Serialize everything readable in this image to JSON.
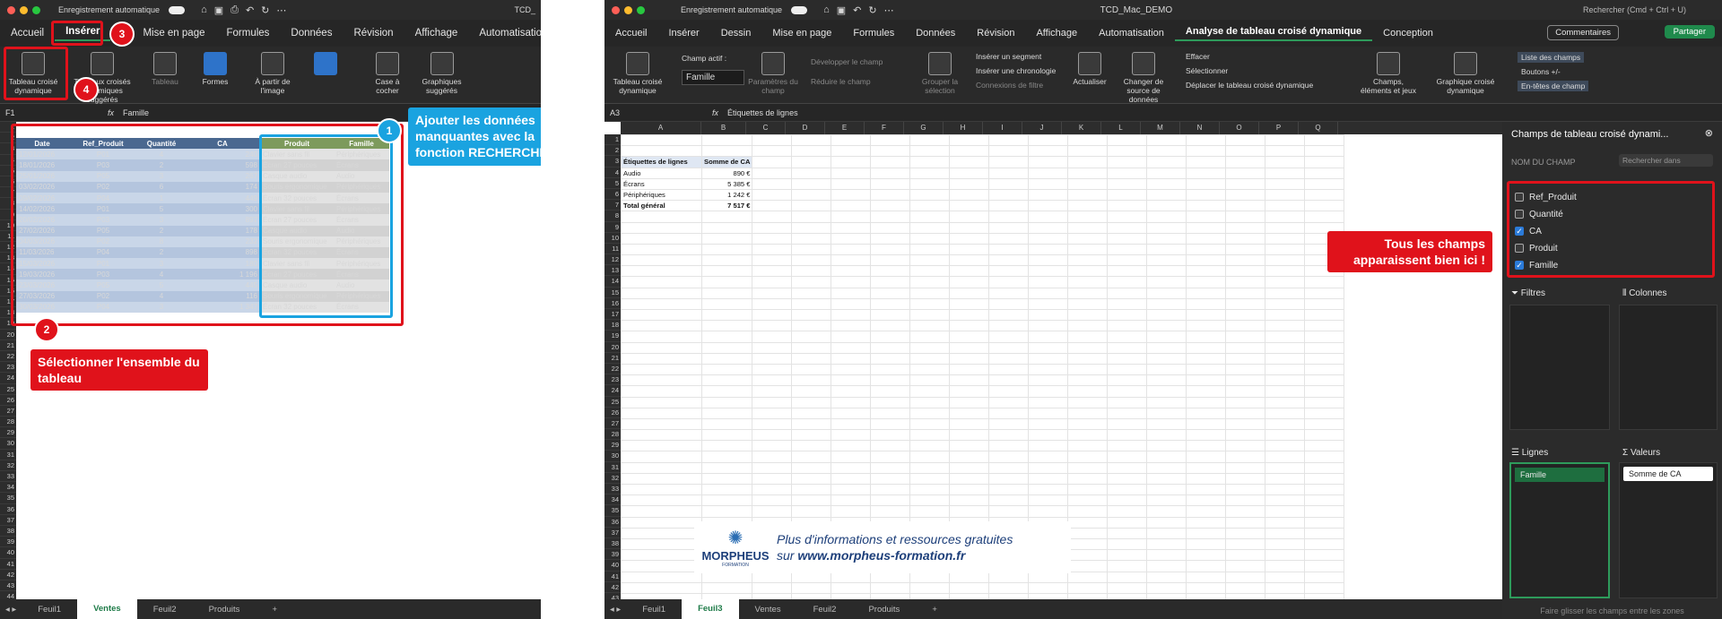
{
  "left": {
    "titlebar": {
      "title": "Enregistrement automatique",
      "doc": "TCD_"
    },
    "tabs": [
      "Accueil",
      "Insérer",
      "Mise en page",
      "Formules",
      "Données",
      "Révision",
      "Affichage",
      "Automatisation"
    ],
    "ribbon": {
      "pivot": "Tableau croisé dynamique",
      "recommended": "Tableaux croisés dynamiques suggérés",
      "table": "Tableau",
      "forms": "Formes",
      "from_image": "À partir de l'image",
      "checkbox": "Case à cocher",
      "charts": "Graphiques suggérés"
    },
    "namebox": "F1",
    "formula": "Famille",
    "headers": [
      "Date",
      "Ref_Produit",
      "Quantité",
      "CA",
      "Produit",
      "Famille"
    ],
    "rows": [
      [
        "12/01/2026",
        "P01",
        "4",
        "240",
        "Clavier sans fil",
        "Périphériques"
      ],
      [
        "18/01/2026",
        "P03",
        "2",
        "598",
        "Écran 27 pouces",
        "Écrans"
      ],
      [
        "25/01/2026",
        "P05",
        "3",
        "267",
        "Casque audio",
        "Audio"
      ],
      [
        "03/02/2026",
        "P02",
        "6",
        "174",
        "Souris ergonomique",
        "Périphériques"
      ],
      [
        "09/02/2026",
        "P04",
        "1",
        "449",
        "Écran 32 pouces",
        "Écrans"
      ],
      [
        "14/02/2026",
        "P01",
        "5",
        "300",
        "Clavier sans fil",
        "Périphériques"
      ],
      [
        "20/02/2026",
        "P03",
        "3",
        "897",
        "Écran 27 pouces",
        "Écrans"
      ],
      [
        "27/02/2026",
        "P05",
        "2",
        "178",
        "Casque audio",
        "Audio"
      ],
      [
        "04/03/2026",
        "P02",
        "8",
        "232",
        "Souris ergonomique",
        "Périphériques"
      ],
      [
        "11/03/2026",
        "P04",
        "2",
        "898",
        "Écran 32 pouces",
        "Écrans"
      ],
      [
        "15/03/2026",
        "P01",
        "3",
        "180",
        "Clavier sans fil",
        "Périphériques"
      ],
      [
        "19/03/2026",
        "P03",
        "4",
        "1 196",
        "Écran 27 pouces",
        "Écrans"
      ],
      [
        "23/03/2026",
        "P05",
        "5",
        "445",
        "Casque audio",
        "Audio"
      ],
      [
        "27/03/2026",
        "P02",
        "4",
        "116",
        "Souris ergonomique",
        "Périphériques"
      ],
      [
        "30/03/2026",
        "P04",
        "3",
        "1 347",
        "Écran 32 pouces",
        "Écrans"
      ]
    ],
    "callouts": {
      "c1": "Ajouter les données manquantes avec la fonction RECHERCHEX",
      "c2": "Sélectionner l'ensemble du tableau",
      "n1": "1",
      "n2": "2",
      "n3": "3",
      "n4": "4"
    },
    "sheets": [
      "Feuil1",
      "Ventes",
      "Feuil2",
      "Produits",
      "+"
    ]
  },
  "right": {
    "titlebar": {
      "title": "Enregistrement automatique",
      "doc": "TCD_Mac_DEMO",
      "search": "Rechercher (Cmd + Ctrl + U)"
    },
    "tabs": [
      "Accueil",
      "Insérer",
      "Dessin",
      "Mise en page",
      "Formules",
      "Données",
      "Révision",
      "Affichage",
      "Automatisation",
      "Analyse de tableau croisé dynamique",
      "Conception"
    ],
    "buttons": {
      "comments": "Commentaires",
      "share": "Partager"
    },
    "ribbon": {
      "pivot": "Tableau croisé dynamique",
      "active_field_label": "Champ actif :",
      "active_field": "Famille",
      "field_settings": "Paramètres du champ",
      "expand": "Développer le champ",
      "collapse": "Réduire le champ",
      "group": "Grouper la sélection",
      "slicer": "Insérer un segment",
      "timeline": "Insérer une chronologie",
      "filter_conn": "Connexions de filtre",
      "refresh": "Actualiser",
      "change_source": "Changer de source de données",
      "clear": "Effacer",
      "select": "Sélectionner",
      "move": "Déplacer le tableau croisé dynamique",
      "fields_items": "Champs, éléments et jeux",
      "pivot_chart": "Graphique croisé dynamique",
      "field_list": "Liste des champs",
      "buttons_pm": "Boutons +/-",
      "headers": "En-têtes de champ"
    },
    "namebox": "A3",
    "formula": "Étiquettes de lignes",
    "columns": [
      "A",
      "B",
      "C",
      "D",
      "E",
      "F",
      "G",
      "H",
      "I",
      "J",
      "K",
      "L",
      "M",
      "N",
      "O",
      "P",
      "Q"
    ],
    "pivot": {
      "header": [
        "Étiquettes de lignes",
        "Somme de CA"
      ],
      "rows": [
        [
          "Audio",
          "890 €"
        ],
        [
          "Écrans",
          "5 385 €"
        ],
        [
          "Périphériques",
          "1 242 €"
        ]
      ],
      "total": [
        "Total général",
        "7 517 €"
      ]
    },
    "panel": {
      "title": "Champs de tableau croisé dynami...",
      "field_name": "NOM DU CHAMP",
      "search": "Rechercher dans",
      "fields": [
        {
          "name": "Ref_Produit",
          "checked": false
        },
        {
          "name": "Quantité",
          "checked": false
        },
        {
          "name": "CA",
          "checked": true
        },
        {
          "name": "Produit",
          "checked": false
        },
        {
          "name": "Famille",
          "checked": true
        }
      ],
      "filters": "Filtres",
      "columns": "Colonnes",
      "rows": "Lignes",
      "values": "Valeurs",
      "row_item": "Famille",
      "value_item": "Somme de CA",
      "hint": "Faire glisser les champs entre les zones"
    },
    "callout": "Tous les champs apparaissent bien ici !",
    "promo": {
      "brand": "MORPHEUS",
      "sub": "FORMATION",
      "line1": "Plus d'informations et ressources gratuites",
      "line2_prefix": "sur",
      "line2_link": "www.morpheus-formation.fr"
    },
    "sheets": [
      "Feuil1",
      "Feuil3",
      "Ventes",
      "Feuil2",
      "Produits",
      "+"
    ]
  },
  "colors": {
    "red": "#e0121b",
    "blue": "#1aa3e0",
    "green": "#1e7b48"
  }
}
